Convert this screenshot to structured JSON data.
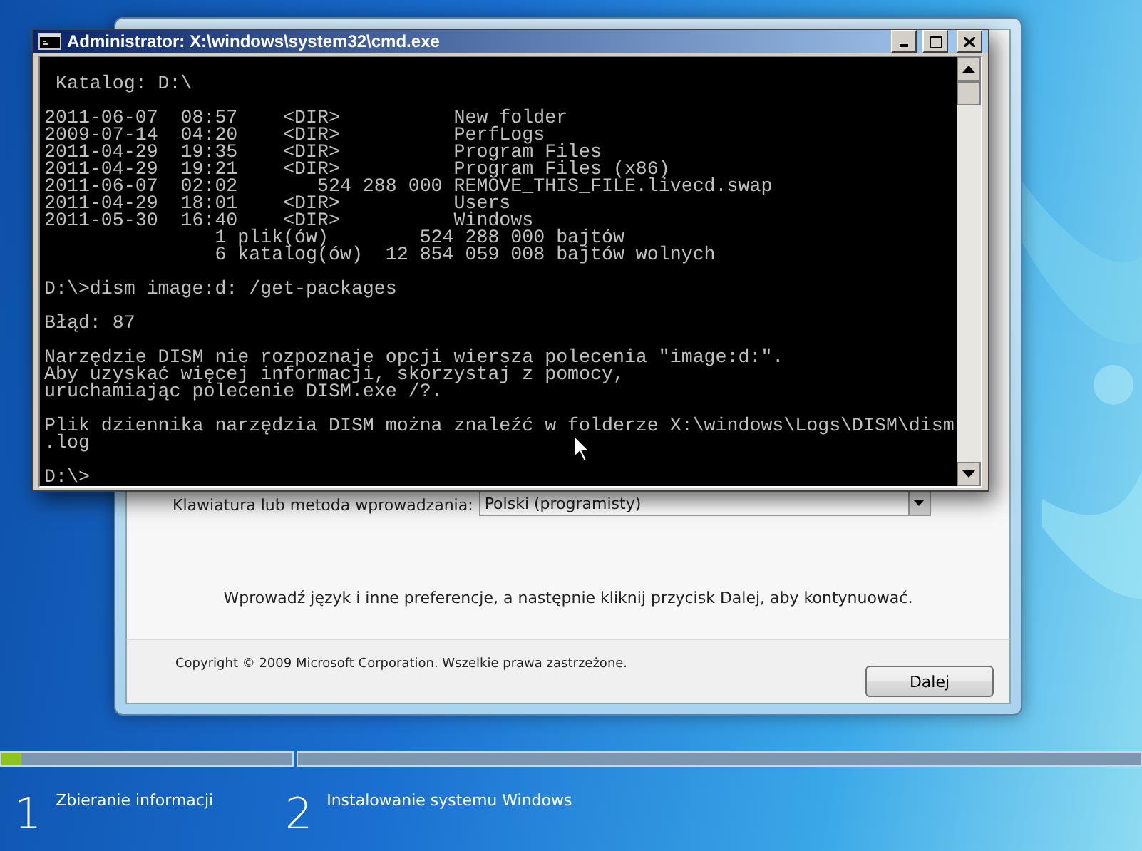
{
  "console_window": {
    "title": "Administrator: X:\\windows\\system32\\cmd.exe",
    "blocks": [
      [
        " Katalog: D:\\"
      ],
      [
        "2011-06-07  08:57    <DIR>          New folder",
        "2009-07-14  04:20    <DIR>          PerfLogs",
        "2011-04-29  19:35    <DIR>          Program Files",
        "2011-04-29  19:21    <DIR>          Program Files (x86)",
        "2011-06-07  02:02       524 288 000 REMOVE_THIS_FILE.livecd.swap",
        "2011-04-29  18:01    <DIR>          Users",
        "2011-05-30  16:40    <DIR>          Windows",
        "               1 plik(ów)        524 288 000 bajtów",
        "               6 katalog(ów)  12 854 059 008 bajtów wolnych"
      ],
      [
        "D:\\>dism image:d: /get-packages"
      ],
      [
        "Błąd: 87"
      ],
      [
        "Narzędzie DISM nie rozpoznaje opcji wiersza polecenia \"image:d:\".",
        "Aby uzyskać więcej informacji, skorzystaj z pomocy,",
        "uruchamiając polecenie DISM.exe /?."
      ],
      [
        "Plik dziennika narzędzia DISM można znaleźć w folderze X:\\windows\\Logs\\DISM\\dism",
        ".log"
      ],
      [
        "D:\\>"
      ]
    ]
  },
  "setup_window": {
    "keyboard_label": "Klawiatura lub metoda wprowadzania:",
    "keyboard_value": "Polski (programisty)",
    "instruction": "Wprowadź język i inne preferencje, a następnie kliknij przycisk Dalej, aby kontynuować.",
    "copyright": "Copyright © 2009 Microsoft Corporation. Wszelkie prawa zastrzeżone.",
    "button": "Dalej"
  },
  "progress": {
    "level": 0.07
  },
  "steps": [
    {
      "number": "1",
      "label": "Zbieranie informacji"
    },
    {
      "number": "2",
      "label": "Instalowanie systemu Windows"
    }
  ]
}
